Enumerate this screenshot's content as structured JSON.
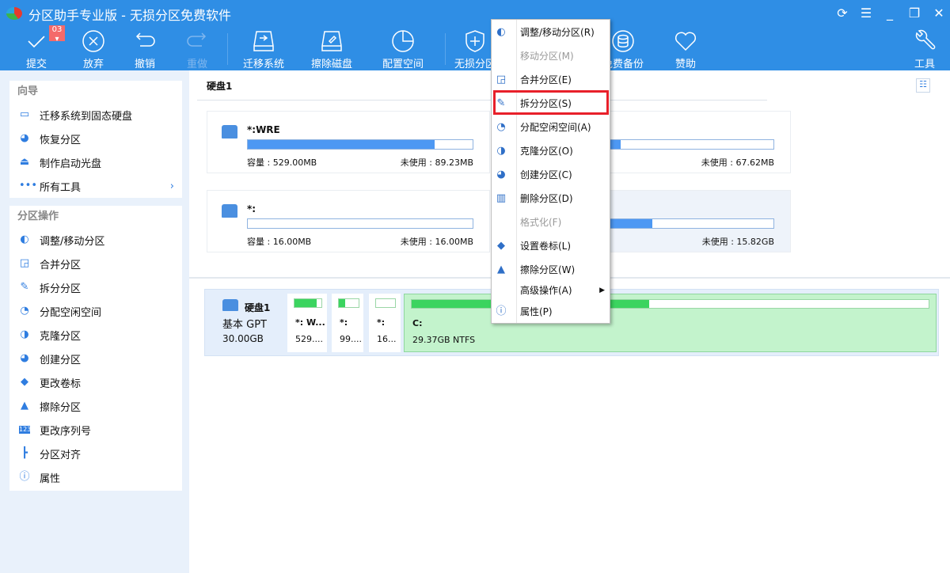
{
  "window": {
    "title": "分区助手专业版 - 无损分区免费软件",
    "controls": [
      "refresh-icon",
      "menu-icon",
      "minimize-icon",
      "restore-icon",
      "close-icon"
    ]
  },
  "toolbar": {
    "badge": "03",
    "items": [
      {
        "label": "提交",
        "icon": "check-icon"
      },
      {
        "label": "放弃",
        "icon": "cancel-circle-icon"
      },
      {
        "label": "撤销",
        "icon": "undo-icon"
      },
      {
        "label": "重做",
        "icon": "redo-icon",
        "disabled": true
      },
      {
        "label": "迁移系统",
        "icon": "migrate-disk-icon"
      },
      {
        "label": "擦除磁盘",
        "icon": "wipe-disk-icon"
      },
      {
        "label": "配置空间",
        "icon": "pie-clock-icon"
      },
      {
        "label": "无损分区",
        "icon": "shield-plus-icon"
      },
      {
        "label": "免费备份",
        "icon": "backup-icon"
      },
      {
        "label": "赞助",
        "icon": "heart-icon"
      },
      {
        "label": "工具",
        "icon": "wrench-icon"
      }
    ]
  },
  "sidebar": {
    "wizard": {
      "title": "向导",
      "items": [
        {
          "label": "迁移系统到固态硬盘"
        },
        {
          "label": "恢复分区"
        },
        {
          "label": "制作启动光盘"
        },
        {
          "label": "所有工具"
        }
      ]
    },
    "ops": {
      "title": "分区操作",
      "items": [
        {
          "label": "调整/移动分区"
        },
        {
          "label": "合并分区"
        },
        {
          "label": "拆分分区"
        },
        {
          "label": "分配空闲空间"
        },
        {
          "label": "克隆分区"
        },
        {
          "label": "创建分区"
        },
        {
          "label": "更改卷标"
        },
        {
          "label": "擦除分区"
        },
        {
          "label": "更改序列号"
        },
        {
          "label": "分区对齐"
        },
        {
          "label": "属性"
        }
      ]
    }
  },
  "disk": {
    "title": "硬盘1",
    "type": "基本 GPT",
    "size": "30.00GB",
    "cards": [
      {
        "name": "*:WRE",
        "capacity": "容量 : 529.00MB",
        "free": "未使用 : 89.23MB",
        "used_pct": 83
      },
      {
        "name": "",
        "capacity": "",
        "free": "未使用 : 67.62MB",
        "used_pct": 32
      },
      {
        "name": "*:",
        "capacity": "容量 : 16.00MB",
        "free": "未使用 : 16.00MB",
        "used_pct": 0
      },
      {
        "name": "",
        "capacity": "",
        "free": "未使用 : 15.82GB",
        "used_pct": 46,
        "selected": true
      }
    ],
    "map": [
      {
        "name": "*: W...",
        "size": "529....",
        "used_pct": 83
      },
      {
        "name": "*:",
        "size": "99....",
        "used_pct": 32
      },
      {
        "name": "*:",
        "size": "16...",
        "used_pct": 0
      },
      {
        "name": "C:",
        "size": "29.37GB NTFS",
        "used_pct": 46
      }
    ]
  },
  "context_menu": {
    "items": [
      {
        "label": "调整/移动分区(R)"
      },
      {
        "label": "移动分区(M)",
        "disabled": true
      },
      {
        "label": "合并分区(E)"
      },
      {
        "label": "拆分分区(S)",
        "highlighted": true
      },
      {
        "label": "分配空闲空间(A)"
      },
      {
        "label": "克隆分区(O)"
      },
      {
        "label": "创建分区(C)"
      },
      {
        "label": "删除分区(D)"
      },
      {
        "label": "格式化(F)",
        "disabled": true
      },
      {
        "label": "设置卷标(L)"
      },
      {
        "label": "擦除分区(W)"
      },
      {
        "label": "高级操作(A)",
        "submenu": true
      },
      {
        "label": "属性(P)"
      }
    ]
  },
  "colors": {
    "toolbar": "#2f8ee5",
    "bar_used": "#4d98f3",
    "map_used": "#3bd45f",
    "highlight": "#e8202a"
  }
}
